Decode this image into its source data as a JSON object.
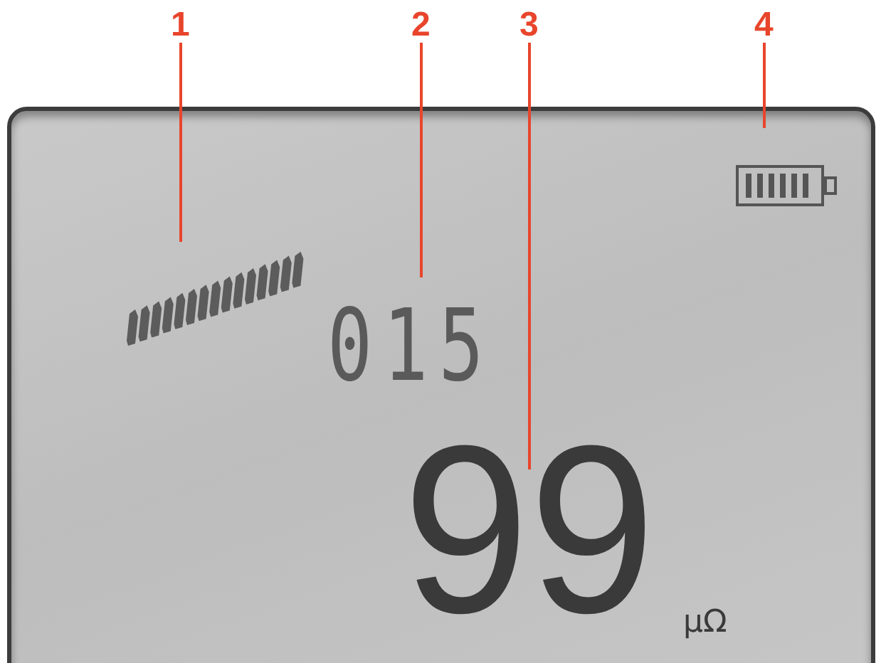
{
  "callouts": [
    {
      "label": "1"
    },
    {
      "label": "2"
    },
    {
      "label": "3"
    },
    {
      "label": "4"
    }
  ],
  "display": {
    "counter": "015",
    "reading": "99",
    "unit": "μΩ"
  }
}
